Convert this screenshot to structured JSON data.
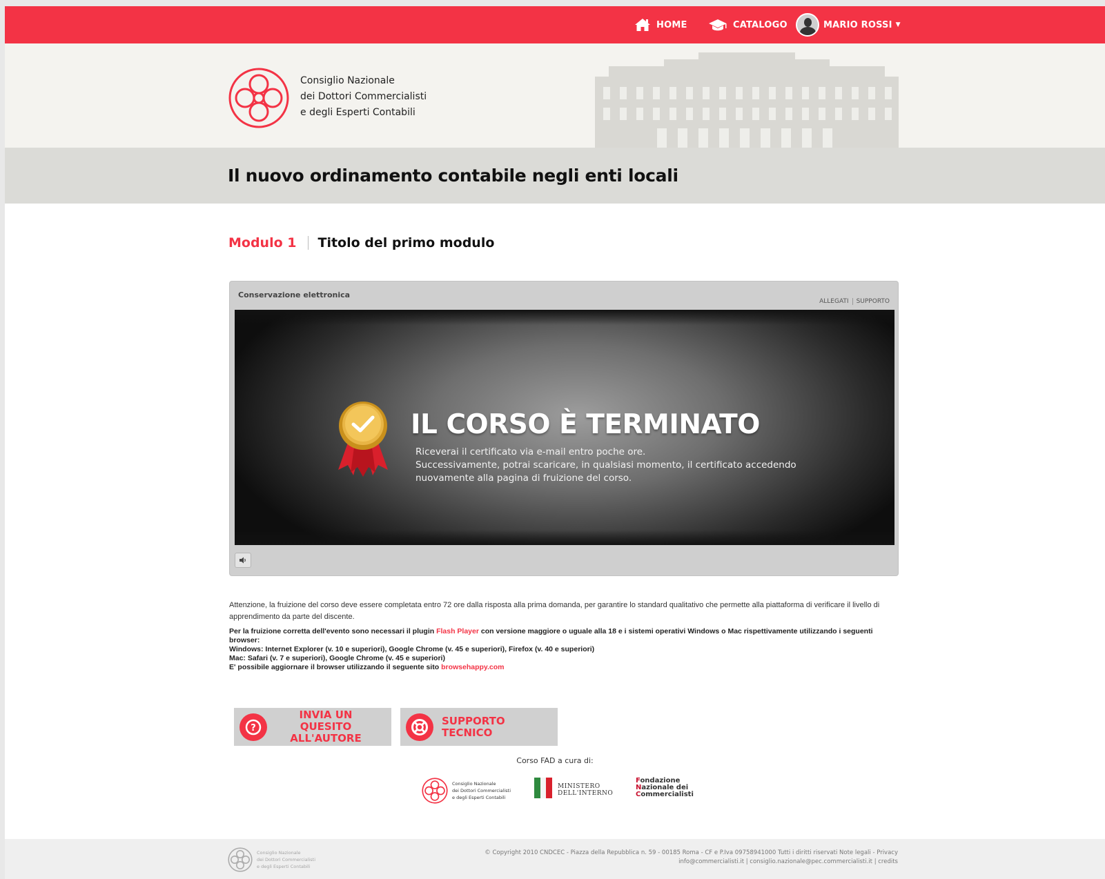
{
  "nav": {
    "home": "HOME",
    "catalog": "CATALOGO",
    "user": "MARIO ROSSI"
  },
  "org": {
    "line1": "Consiglio Nazionale",
    "line2": "dei Dottori Commercialisti",
    "line3": "e degli Esperti Contabili"
  },
  "course": {
    "title": "Il nuovo ordinamento contabile negli enti locali"
  },
  "module": {
    "number": "Modulo 1",
    "title": "Titolo del primo modulo"
  },
  "player": {
    "title": "Conservazione elettronica",
    "links": [
      "ALLEGATI",
      "SUPPORTO"
    ],
    "headline": "IL CORSO È TERMINATO",
    "lines": [
      "Riceverai il certificato via e-mail entro poche ore.",
      "Successivamente, potrai scaricare, in qualsiasi momento, il certificato accedendo",
      "nuovamente alla pagina di fruizione del corso."
    ]
  },
  "notes": {
    "warning": "Attenzione, la fruizione del corso deve essere completata entro 72 ore dalla risposta alla prima domanda, per garantire lo standard qualitativo che permette alla piattaforma di verificare il livello di apprendimento da parte del discente.",
    "plugin_before": "Per la fruizione corretta dell'evento sono necessari il plugin ",
    "plugin_link": "Flash Player",
    "plugin_after": " con versione maggiore o uguale alla 18 e i sistemi operativi Windows o Mac rispettivamente utilizzando i seguenti browser:",
    "windows": "Windows: Internet Explorer (v. 10 e superiori), Google Chrome (v. 45 e superiori), Firefox (v. 40 e superiori)",
    "mac": "Mac: Safari (v. 7 e superiori), Google Chrome (v. 45 e superiori)",
    "update_before": "E' possibile aggiornare il browser utilizzando il seguente sito ",
    "update_link": "browsehappy.com"
  },
  "actions": {
    "quesito_l1": "INVIA UN QUESITO",
    "quesito_l2": "ALL'AUTORE",
    "supporto_l1": "SUPPORTO",
    "supporto_l2": "TECNICO"
  },
  "partners": {
    "caption": "Corso FAD a cura di:",
    "cndcec": [
      "Consiglio Nazionale",
      "dei Dottori Commercialisti",
      "e degli Esperti Contabili"
    ],
    "ministero": [
      "MINISTERO",
      "DELL'INTERNO"
    ],
    "fondazione": [
      "Fondazione",
      "Nazionale dei",
      "Commercialisti"
    ]
  },
  "footer": {
    "line1": "© Copyright 2010  CNDCEC  - Piazza della Repubblica n. 59 - 00185 Roma - CF e P.Iva 09758941000 Tutti i diritti riservati Note legali  - Privacy",
    "line2": "info@commercialisti.it | consiglio.nazionale@pec.commercialisti.it | credits",
    "logo": [
      "Consiglio Nazionale",
      "dei Dottori Commercialisti",
      "e degli Esperti Contabili"
    ]
  },
  "colors": {
    "brand_red": "#f33345",
    "header_bg": "#f4f3ef",
    "title_band": "#dbdbd7",
    "button_grey": "#d0d0d0"
  },
  "icons": [
    "home-icon",
    "graduation-cap-icon",
    "avatar",
    "caret-down-icon",
    "medal-icon",
    "volume-icon",
    "question-icon",
    "lifebuoy-icon"
  ]
}
